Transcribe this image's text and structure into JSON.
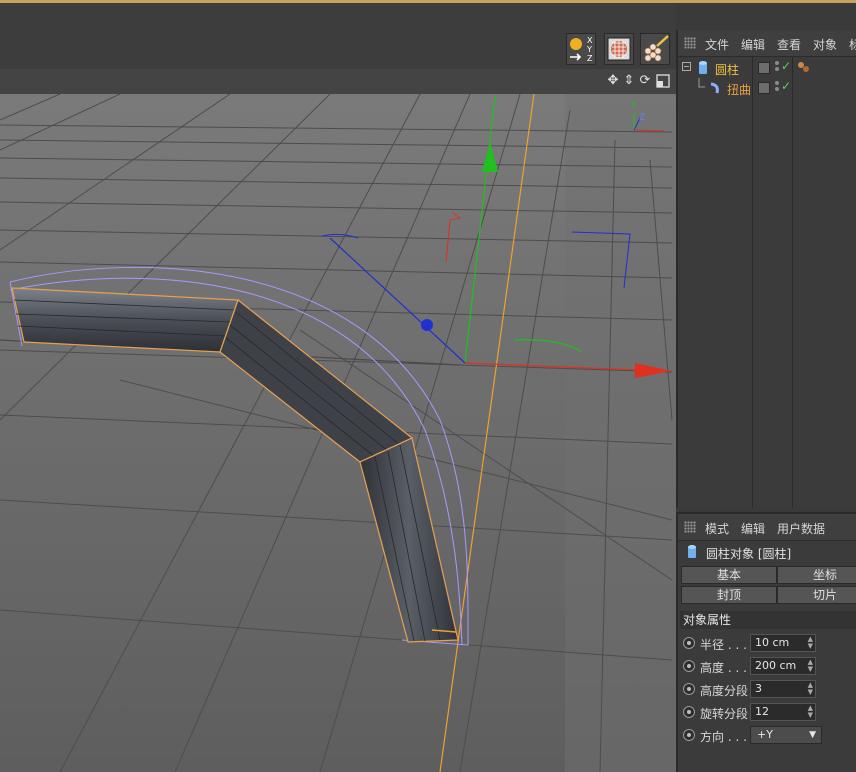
{
  "toolbar": {
    "buttons": [
      "axis-xyz-icon",
      "checker-render-icon",
      "paint-brush-icon"
    ],
    "axis_letters": [
      "X",
      "Y",
      "Z"
    ]
  },
  "viewport": {
    "nav_icons": [
      "move-view-icon",
      "dolly-view-icon",
      "rotate-view-icon",
      "maximize-view-icon"
    ],
    "gizmo_axes": [
      "Y",
      "Z"
    ],
    "colors": {
      "background": "#6a6a6a",
      "grid": "#4a4a4a",
      "x_axis": "#e03020",
      "y_axis": "#20c020",
      "z_axis": "#2030d0",
      "deformer_cage": "#a898ff",
      "selection_outline": "#e8a050"
    }
  },
  "object_manager": {
    "menu": [
      "文件",
      "编辑",
      "查看",
      "对象",
      "标"
    ],
    "objects": [
      {
        "name": "圆柱",
        "color": "#f0c040",
        "icon": "cylinder-icon"
      },
      {
        "name": "扭曲",
        "color": "#e8a040",
        "icon": "bend-deformer-icon"
      }
    ]
  },
  "attributes": {
    "menu": [
      "模式",
      "编辑",
      "用户数据"
    ],
    "object_title": "圆柱对象 [圆柱]",
    "tabs": [
      "基本",
      "坐标",
      "封顶",
      "切片"
    ],
    "section": "对象属性",
    "params": [
      {
        "label": "半径 . . .",
        "value": "10 cm"
      },
      {
        "label": "高度 . . .",
        "value": "200 cm"
      },
      {
        "label": "高度分段",
        "value": "3"
      },
      {
        "label": "旋转分段",
        "value": "12"
      }
    ],
    "orientation": {
      "label": "方向 . . .",
      "value": "+Y"
    }
  }
}
